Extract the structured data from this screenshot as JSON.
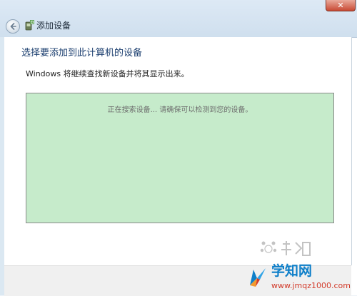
{
  "window": {
    "title": "添加设备",
    "close_glyph": "✕"
  },
  "wizard": {
    "heading": "选择要添加到此计算机的设备",
    "info": "Windows 将继续查找新设备并将其显示出来。",
    "searching_text": "正在搜索设备... 请确保可以检测到您的设备。"
  },
  "icons": {
    "back": "back-arrow-icon",
    "app": "add-device-icon",
    "close": "close-icon"
  },
  "watermark": {
    "brand": "学知网",
    "url": "www.jmqz1000.com"
  },
  "colors": {
    "device_area_bg": "#c6ebcb",
    "heading": "#1a3d6e",
    "watermark_brand": "#0e7fc9",
    "watermark_url": "#d23a2a"
  }
}
